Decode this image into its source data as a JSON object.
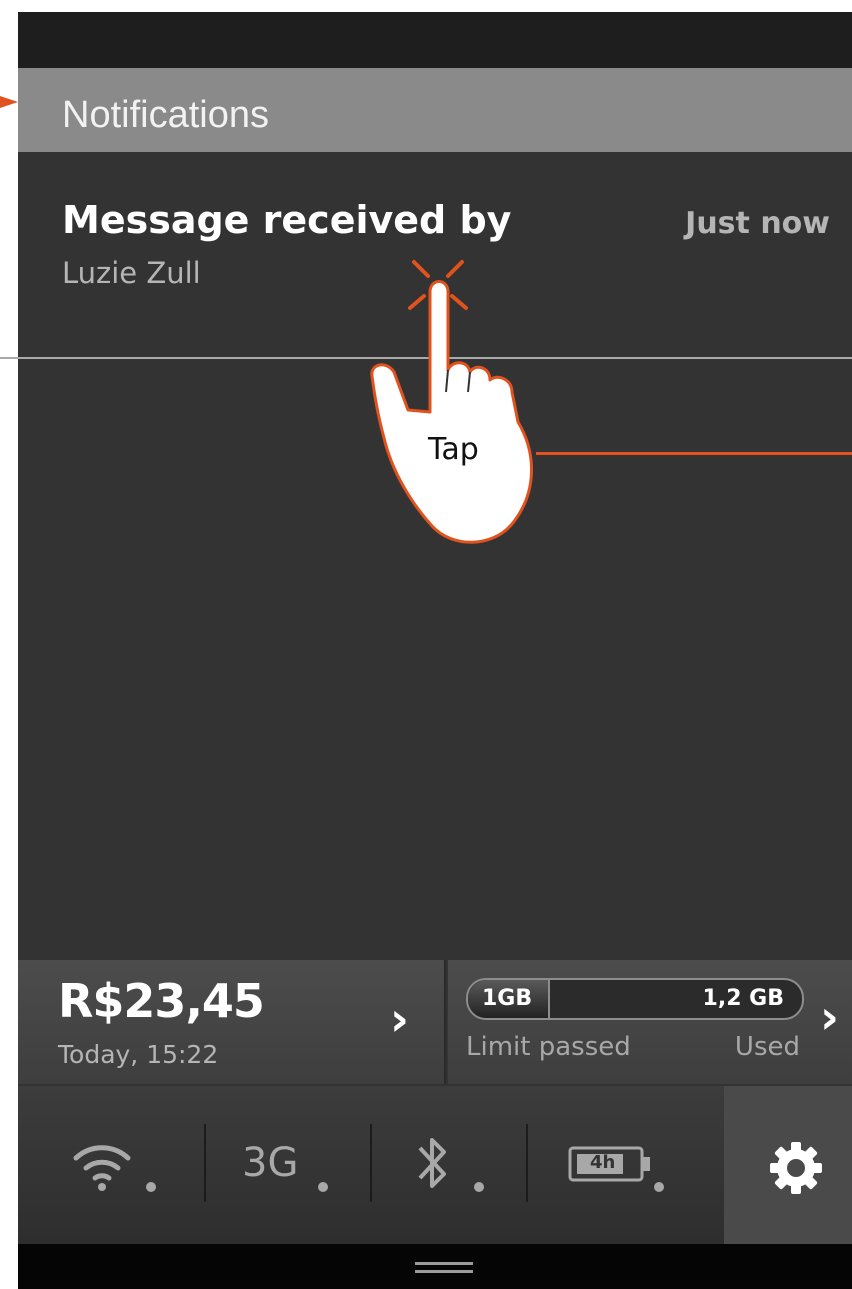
{
  "notifications": {
    "header": "Notifications",
    "item": {
      "title": "Message received by",
      "sender": "Luzie Zull",
      "time": "Just now"
    }
  },
  "balance": {
    "amount": "R$23,45",
    "time": "Today, 15:22"
  },
  "data_usage": {
    "limit_label": "1GB",
    "used_label": "1,2 GB",
    "limit_status": "Limit passed",
    "used_status": "Used",
    "limit_fraction_of_bar": 0.24
  },
  "quick_settings": {
    "network_label": "3G",
    "battery_label": "4h"
  },
  "annotation": {
    "tap_label": "Tap",
    "accent_color": "#e0521e"
  }
}
